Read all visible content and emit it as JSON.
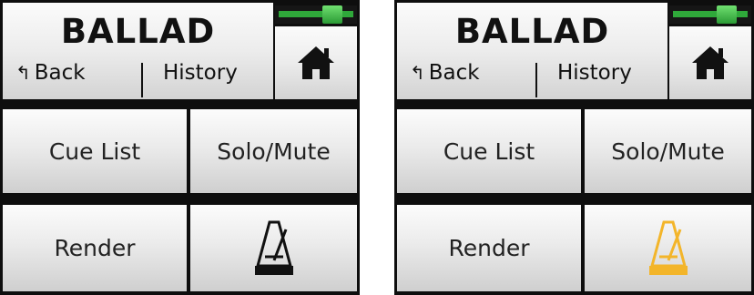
{
  "panels": [
    {
      "title": "BALLAD",
      "back_arrow": "↰",
      "back_label": "Back",
      "history_label": "History",
      "cue_list_label": "Cue List",
      "solo_mute_label": "Solo/Mute",
      "render_label": "Render",
      "metronome_color": "#111111",
      "metronome_active": false
    },
    {
      "title": "BALLAD",
      "back_arrow": "↰",
      "back_label": "Back",
      "history_label": "History",
      "cue_list_label": "Cue List",
      "solo_mute_label": "Solo/Mute",
      "render_label": "Render",
      "metronome_color": "#f3b52a",
      "metronome_active": true
    }
  ],
  "colors": {
    "fader_green": "#2fa83a",
    "panel_bg": "#0e0e0e"
  },
  "icons": {
    "home": "home-icon",
    "metronome": "metronome-icon",
    "back": "back-arrow-icon"
  }
}
